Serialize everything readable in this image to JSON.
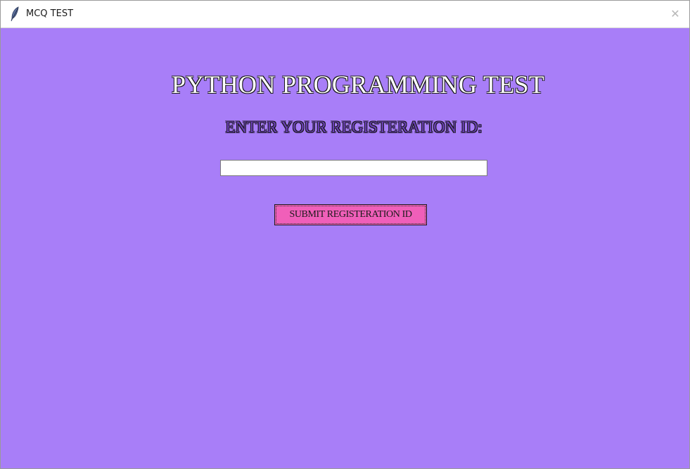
{
  "window": {
    "title": "MCQ TEST",
    "close_glyph": "✕",
    "icon": "feather-icon"
  },
  "main": {
    "heading": "PYTHON PROGRAMMING TEST",
    "prompt": "ENTER YOUR REGISTERATION ID:",
    "registration_input": {
      "value": "",
      "placeholder": ""
    },
    "submit_label": "SUBMIT REGISTERATION ID"
  },
  "colors": {
    "background": "#a87ef8",
    "button": "#f05fb9",
    "heading_fill": "#ffffff",
    "prompt_fill": "#6a3fb7"
  }
}
